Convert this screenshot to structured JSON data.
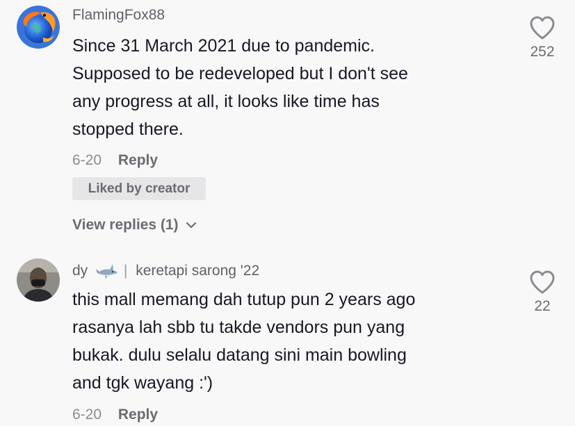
{
  "comments": [
    {
      "username": "FlamingFox88",
      "avatar_icon": "fox-globe-avatar",
      "text": "Since 31 March 2021 due to pandemic.\nSupposed to be redeveloped but I don't see\nany progress at all, it looks like time has\nstopped there.",
      "date": "6-20",
      "reply_label": "Reply",
      "liked_by_creator": "Liked by creator",
      "view_replies": "View replies (1)",
      "likes": "252"
    },
    {
      "username": "dy",
      "badge_icon": "shark-emoji-icon",
      "user_sep": "|",
      "user_extra": "keretapi sarong '22",
      "avatar_icon": "person-photo-avatar",
      "text": "this mall memang dah tutup pun 2 years ago\nrasanya lah sbb tu takde vendors pun yang\nbukak. dulu selalu datang sini main bowling\nand tgk wayang :')",
      "date": "6-20",
      "reply_label": "Reply",
      "likes": "22"
    }
  ],
  "colors": {
    "background": "#f8f8f8",
    "text_primary": "#161823",
    "text_secondary": "#8a8b91",
    "chip_bg": "#e6e6e8"
  }
}
